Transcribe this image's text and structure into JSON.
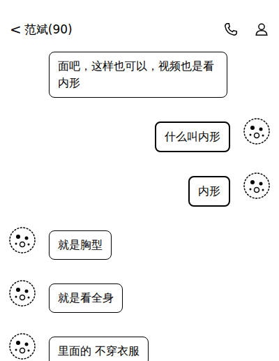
{
  "header": {
    "back": "<",
    "title": "范斌(90)"
  },
  "messages": [
    {
      "side": "left",
      "text": "面吧，这样也可以，视频也是看内形",
      "avatar": false
    },
    {
      "side": "right",
      "text": "什么叫内形",
      "avatar": true
    },
    {
      "side": "right",
      "text": "内形",
      "avatar": true
    },
    {
      "side": "left",
      "text": "就是胸型",
      "avatar": true
    },
    {
      "side": "left",
      "text": "就是看全身",
      "avatar": true
    },
    {
      "side": "left",
      "text": "里面的 不穿衣服",
      "avatar": true
    }
  ]
}
